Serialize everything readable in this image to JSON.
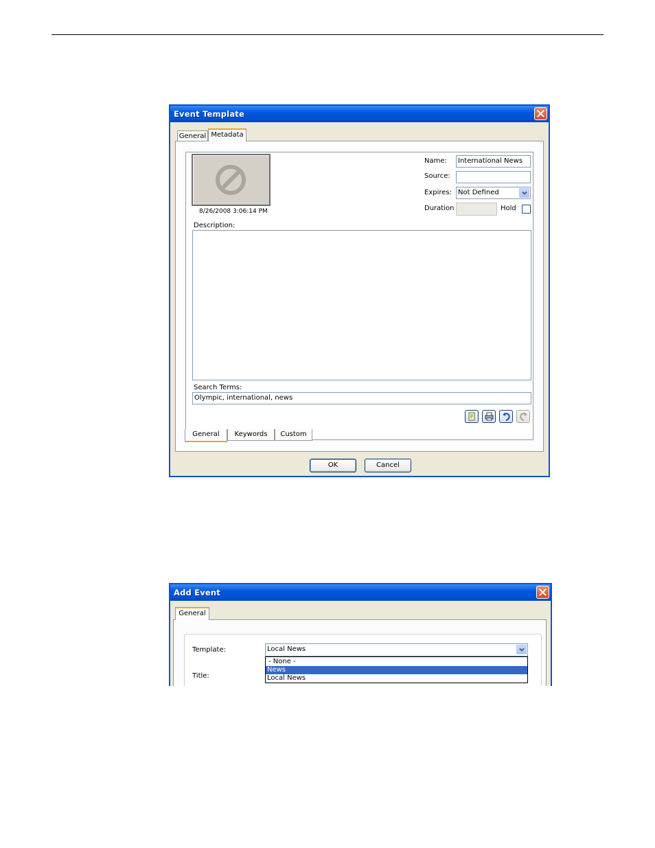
{
  "event_template": {
    "title": "Event Template",
    "tabs": [
      "General",
      "Metadata"
    ],
    "thumbnail_timestamp": "8/26/2008 3:06:14 PM",
    "labels": {
      "name": "Name:",
      "source": "Source:",
      "expires": "Expires:",
      "duration": "Duration",
      "hold": "Hold",
      "description": "Description:",
      "search_terms": "Search Terms:"
    },
    "values": {
      "name": "International News",
      "source": "",
      "expires": "Not Defined",
      "duration": "",
      "description": "",
      "search_terms": "Olympic, international, news"
    },
    "hold_checked": false,
    "bottom_tabs": [
      "General",
      "Keywords",
      "Custom"
    ],
    "toolbar_icons": [
      "edit-icon",
      "print-icon",
      "undo-icon",
      "redo-icon"
    ],
    "buttons": {
      "ok": "OK",
      "cancel": "Cancel"
    }
  },
  "add_event": {
    "title": "Add Event",
    "tabs": [
      "General"
    ],
    "labels": {
      "template": "Template:",
      "title": "Title:"
    },
    "template_value": "Local News",
    "template_options": [
      "- None -",
      "News",
      "Local News"
    ],
    "selected_option_index": 1
  },
  "colors": {
    "title_bar": "#0058e0",
    "close_button": "#d3482b",
    "selection": "#316ac5",
    "active_tab_accent": "#f0a030",
    "dialog_face": "#ece9d8"
  }
}
